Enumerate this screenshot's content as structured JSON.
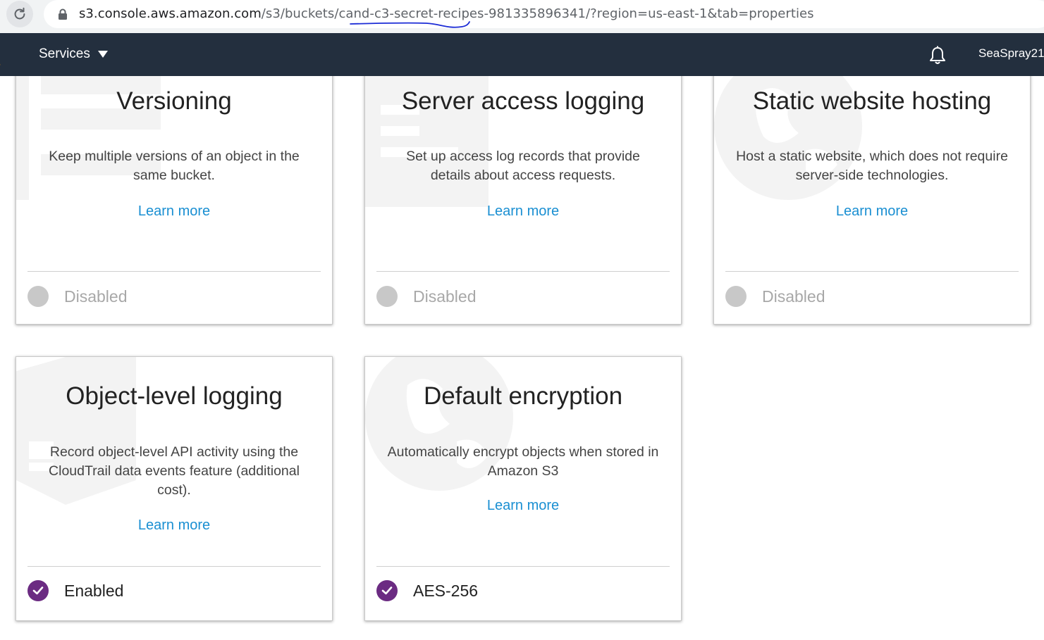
{
  "browser": {
    "url_host": "s3.console.aws.amazon.com",
    "url_path": "/s3/buckets/cand-c3-secret-recipes-981335896341/?region=us-east-1&tab=properties"
  },
  "nav": {
    "services_label": "Services",
    "account_label": "SeaSpray21"
  },
  "cards": [
    {
      "title": "Versioning",
      "description": "Keep multiple versions of an object in the same bucket.",
      "learn_more": "Learn more",
      "status": "Disabled",
      "enabled": false
    },
    {
      "title": "Server access logging",
      "description": "Set up access log records that provide details about access requests.",
      "learn_more": "Learn more",
      "status": "Disabled",
      "enabled": false
    },
    {
      "title": "Static website hosting",
      "description": "Host a static website, which does not require server-side technologies.",
      "learn_more": "Learn more",
      "status": "Disabled",
      "enabled": false
    },
    {
      "title": "Object-level logging",
      "description": "Record object-level API activity using the CloudTrail data events feature (additional cost).",
      "learn_more": "Learn more",
      "status": "Enabled",
      "enabled": true
    },
    {
      "title": "Default encryption",
      "description": "Automatically encrypt objects when stored in Amazon S3",
      "learn_more": "Learn more",
      "status": "AES-256",
      "enabled": true
    }
  ],
  "colors": {
    "nav_bg": "#232f3e",
    "link": "#1a8fd2",
    "enabled_dot": "#6b2b82",
    "disabled_dot": "#c8c8c8"
  }
}
